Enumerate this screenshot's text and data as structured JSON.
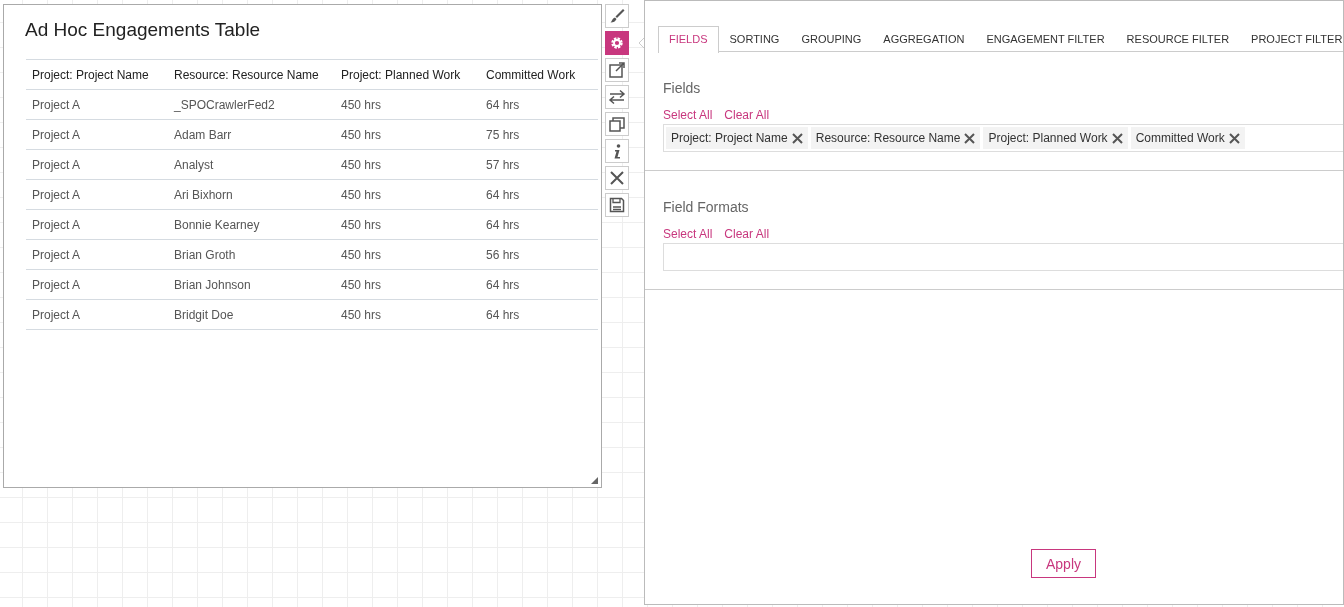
{
  "widget": {
    "title": "Ad Hoc Engagements Table",
    "table": {
      "columns": [
        "Project: Project Name",
        "Resource: Resource Name",
        "Project: Planned Work",
        "Committed Work"
      ],
      "rows": [
        [
          "Project A",
          "_SPOCrawlerFed2",
          "450 hrs",
          "64 hrs"
        ],
        [
          "Project A",
          "Adam Barr",
          "450 hrs",
          "75 hrs"
        ],
        [
          "Project A",
          "Analyst",
          "450 hrs",
          "57 hrs"
        ],
        [
          "Project A",
          "Ari Bixhorn",
          "450 hrs",
          "64 hrs"
        ],
        [
          "Project A",
          "Bonnie Kearney",
          "450 hrs",
          "64 hrs"
        ],
        [
          "Project A",
          "Brian Groth",
          "450 hrs",
          "56 hrs"
        ],
        [
          "Project A",
          "Brian Johnson",
          "450 hrs",
          "64 hrs"
        ],
        [
          "Project A",
          "Bridgit Doe",
          "450 hrs",
          "64 hrs"
        ]
      ]
    }
  },
  "toolbar": [
    {
      "kind": "brush",
      "selected": false
    },
    {
      "kind": "gear",
      "selected": true
    },
    {
      "kind": "popout",
      "selected": false
    },
    {
      "kind": "swap",
      "selected": false
    },
    {
      "kind": "windows",
      "selected": false
    },
    {
      "kind": "info",
      "selected": false
    },
    {
      "kind": "close",
      "selected": false
    },
    {
      "kind": "save",
      "selected": false
    }
  ],
  "panel": {
    "tabs": [
      {
        "label": "FIELDS",
        "selected": true
      },
      {
        "label": "SORTING",
        "selected": false
      },
      {
        "label": "GROUPING",
        "selected": false
      },
      {
        "label": "AGGREGATION",
        "selected": false
      },
      {
        "label": "ENGAGEMENT FILTER",
        "selected": false
      },
      {
        "label": "RESOURCE FILTER",
        "selected": false
      },
      {
        "label": "PROJECT FILTER",
        "selected": false
      }
    ],
    "sections": [
      {
        "heading": "Fields",
        "select_all": "Select All",
        "clear_all": "Clear All",
        "chips": [
          "Project: Project Name",
          "Resource: Resource Name",
          "Project: Planned Work",
          "Committed Work"
        ]
      },
      {
        "heading": "Field Formats",
        "select_all": "Select All",
        "clear_all": "Clear All"
      }
    ],
    "apply": "Apply"
  }
}
